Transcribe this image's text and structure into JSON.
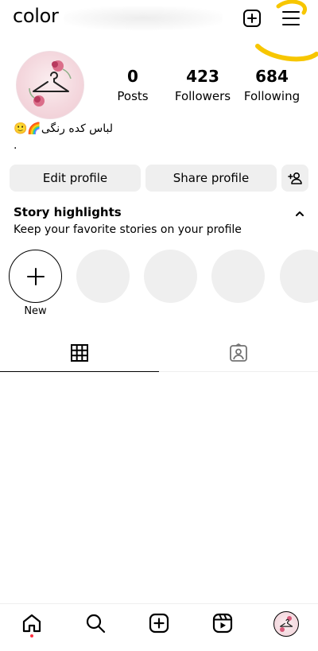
{
  "header": {
    "username": "color"
  },
  "profile": {
    "posts_count": "0",
    "posts_label": "Posts",
    "followers_count": "423",
    "followers_label": "Followers",
    "following_count": "684",
    "following_label": "Following",
    "bio_name": "🙂🌈لباس کده رنگی",
    "bio_line2": "."
  },
  "actions": {
    "edit_label": "Edit profile",
    "share_label": "Share profile"
  },
  "highlights": {
    "title": "Story highlights",
    "subtitle": "Keep your favorite stories on your profile",
    "new_label": "New"
  },
  "colors": {
    "accent_scribble": "#f7c600",
    "button_bg": "#efefef",
    "notification_dot": "#ff3040"
  },
  "icons": {
    "top": [
      "create-icon",
      "menu-icon"
    ],
    "tabs": [
      "grid-icon",
      "tagged-icon"
    ],
    "nav": [
      "home-icon",
      "search-icon",
      "create-icon",
      "reels-icon",
      "profile-avatar"
    ]
  }
}
